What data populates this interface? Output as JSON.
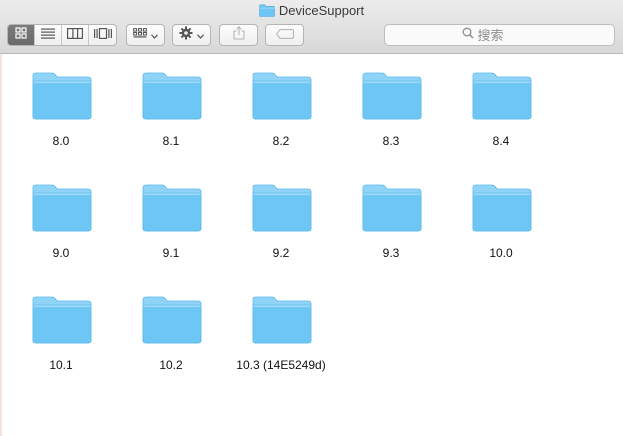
{
  "window": {
    "title": "DeviceSupport"
  },
  "toolbar": {
    "view_buttons": [
      {
        "icon": "icon-view-icon",
        "active": true
      },
      {
        "icon": "list-view-icon",
        "active": false
      },
      {
        "icon": "column-view-icon",
        "active": false
      },
      {
        "icon": "cover-flow-icon",
        "active": false
      }
    ],
    "arrange_icon": "arrange-grid-icon",
    "action_icon": "gear-icon",
    "share_icon": "share-icon",
    "tags_icon": "tag-icon",
    "search": {
      "placeholder": "搜索",
      "value": ""
    }
  },
  "colors": {
    "folder": "#6ec6f5",
    "folder_tab": "#8fd4f8",
    "active_segment": "#6f6f6f"
  },
  "folders": [
    {
      "name": "8.0"
    },
    {
      "name": "8.1"
    },
    {
      "name": "8.2"
    },
    {
      "name": "8.3"
    },
    {
      "name": "8.4"
    },
    {
      "name": "9.0"
    },
    {
      "name": "9.1"
    },
    {
      "name": "9.2"
    },
    {
      "name": "9.3"
    },
    {
      "name": "10.0"
    },
    {
      "name": "10.1"
    },
    {
      "name": "10.2"
    },
    {
      "name": "10.3 (14E5249d)"
    }
  ]
}
